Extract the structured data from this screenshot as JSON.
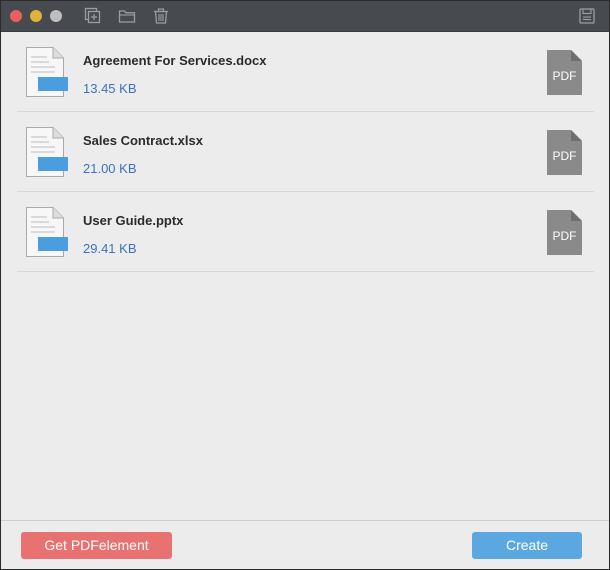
{
  "colors": {
    "titlebar": "#474a4f",
    "close": "#ec5f5c",
    "minimize": "#e2b13b",
    "maximize": "#bfbfbf",
    "toolbar_icon": "#9a9da2",
    "file_size_text": "#3a72c0",
    "doc_badge": "#4a9ede",
    "pdf_icon": "#8a8a8a",
    "get_button": "#e87272",
    "create_button": "#5ba8e0"
  },
  "toolbar": {
    "icons": [
      "add-file-icon",
      "folder-icon",
      "trash-icon",
      "save-icon"
    ]
  },
  "files": [
    {
      "name": "Agreement For Services.docx",
      "size": "13.45 KB",
      "target_label": "PDF"
    },
    {
      "name": "Sales Contract.xlsx",
      "size": "21.00 KB",
      "target_label": "PDF"
    },
    {
      "name": "User Guide.pptx",
      "size": "29.41 KB",
      "target_label": "PDF"
    }
  ],
  "footer": {
    "get_label": "Get PDFelement",
    "create_label": "Create"
  }
}
